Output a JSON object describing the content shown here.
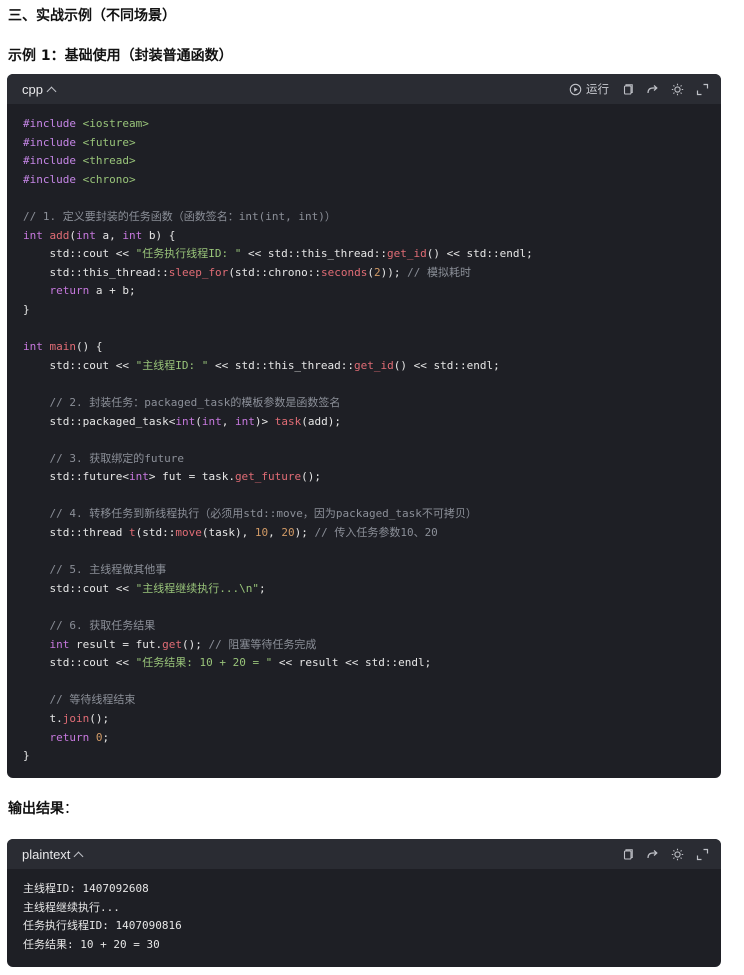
{
  "headings": {
    "section": "三、实战示例（不同场景）",
    "example": "示例 1：基础使用（封装普通函数）"
  },
  "output_label": {
    "bold": "输出结果",
    "suffix": "："
  },
  "code_block": {
    "language": "cpp",
    "run_label": "运行",
    "icons": [
      "play-icon",
      "copy-icon",
      "share-icon",
      "theme-icon",
      "expand-icon"
    ],
    "lines": [
      [
        [
          "prep",
          "#include "
        ],
        [
          "inc",
          "<iostream>"
        ]
      ],
      [
        [
          "prep",
          "#include "
        ],
        [
          "inc",
          "<future>"
        ]
      ],
      [
        [
          "prep",
          "#include "
        ],
        [
          "inc",
          "<thread>"
        ]
      ],
      [
        [
          "prep",
          "#include "
        ],
        [
          "inc",
          "<chrono>"
        ]
      ],
      [],
      [
        [
          "com",
          "// 1. 定义要封装的任务函数（函数签名：int(int, int)）"
        ]
      ],
      [
        [
          "kw",
          "int "
        ],
        [
          "fn",
          "add"
        ],
        [
          "tx",
          "("
        ],
        [
          "kw",
          "int"
        ],
        [
          "tx",
          " a, "
        ],
        [
          "kw",
          "int"
        ],
        [
          "tx",
          " b) {"
        ]
      ],
      [
        [
          "tx",
          "    std::cout << "
        ],
        [
          "str",
          "\"任务执行线程ID: \""
        ],
        [
          "tx",
          " << std::this_thread::"
        ],
        [
          "fn",
          "get_id"
        ],
        [
          "tx",
          "() << std::endl;"
        ]
      ],
      [
        [
          "tx",
          "    std::this_thread::"
        ],
        [
          "fn",
          "sleep_for"
        ],
        [
          "tx",
          "(std::chrono::"
        ],
        [
          "fn",
          "seconds"
        ],
        [
          "tx",
          "("
        ],
        [
          "num",
          "2"
        ],
        [
          "tx",
          "));"
        ],
        [
          "com",
          " // 模拟耗时"
        ]
      ],
      [
        [
          "kw",
          "    return"
        ],
        [
          "tx",
          " a + b;"
        ]
      ],
      [
        [
          "tx",
          "}"
        ]
      ],
      [],
      [
        [
          "kw",
          "int "
        ],
        [
          "fn",
          "main"
        ],
        [
          "tx",
          "() {"
        ]
      ],
      [
        [
          "tx",
          "    std::cout << "
        ],
        [
          "str",
          "\"主线程ID: \""
        ],
        [
          "tx",
          " << std::this_thread::"
        ],
        [
          "fn",
          "get_id"
        ],
        [
          "tx",
          "() << std::endl;"
        ]
      ],
      [],
      [
        [
          "com",
          "    // 2. 封装任务：packaged_task的模板参数是函数签名"
        ]
      ],
      [
        [
          "tx",
          "    std::packaged_task<"
        ],
        [
          "kw",
          "int"
        ],
        [
          "tx",
          "("
        ],
        [
          "kw",
          "int"
        ],
        [
          "tx",
          ", "
        ],
        [
          "kw",
          "int"
        ],
        [
          "tx",
          ")> "
        ],
        [
          "fn",
          "task"
        ],
        [
          "tx",
          "(add);"
        ]
      ],
      [],
      [
        [
          "com",
          "    // 3. 获取绑定的future"
        ]
      ],
      [
        [
          "tx",
          "    std::future<"
        ],
        [
          "kw",
          "int"
        ],
        [
          "tx",
          "> fut = task."
        ],
        [
          "fn",
          "get_future"
        ],
        [
          "tx",
          "();"
        ]
      ],
      [],
      [
        [
          "com",
          "    // 4. 转移任务到新线程执行（必须用std::move，因为packaged_task不可拷贝）"
        ]
      ],
      [
        [
          "tx",
          "    std::thread "
        ],
        [
          "fn",
          "t"
        ],
        [
          "tx",
          "(std::"
        ],
        [
          "fn",
          "move"
        ],
        [
          "tx",
          "(task), "
        ],
        [
          "num",
          "10"
        ],
        [
          "tx",
          ", "
        ],
        [
          "num",
          "20"
        ],
        [
          "tx",
          ");"
        ],
        [
          "com",
          " // 传入任务参数10、20"
        ]
      ],
      [],
      [
        [
          "com",
          "    // 5. 主线程做其他事"
        ]
      ],
      [
        [
          "tx",
          "    std::cout << "
        ],
        [
          "str",
          "\"主线程继续执行...\\n\""
        ],
        [
          "tx",
          ";"
        ]
      ],
      [],
      [
        [
          "com",
          "    // 6. 获取任务结果"
        ]
      ],
      [
        [
          "kw",
          "    int"
        ],
        [
          "tx",
          " result = fut."
        ],
        [
          "fn",
          "get"
        ],
        [
          "tx",
          "();"
        ],
        [
          "com",
          " // 阻塞等待任务完成"
        ]
      ],
      [
        [
          "tx",
          "    std::cout << "
        ],
        [
          "str",
          "\"任务结果: 10 + 20 = \""
        ],
        [
          "tx",
          " << result << std::endl;"
        ]
      ],
      [],
      [
        [
          "com",
          "    // 等待线程结束"
        ]
      ],
      [
        [
          "tx",
          "    t."
        ],
        [
          "fn",
          "join"
        ],
        [
          "tx",
          "();"
        ]
      ],
      [
        [
          "kw",
          "    return "
        ],
        [
          "num",
          "0"
        ],
        [
          "tx",
          ";"
        ]
      ],
      [
        [
          "tx",
          "}"
        ]
      ]
    ]
  },
  "output_block": {
    "language": "plaintext",
    "icons": [
      "copy-icon",
      "share-icon",
      "theme-icon",
      "expand-icon"
    ],
    "lines": [
      "主线程ID: 1407092608",
      "主线程继续执行...",
      "任务执行线程ID: 1407090816",
      "任务结果: 10 + 20 = 30"
    ]
  }
}
